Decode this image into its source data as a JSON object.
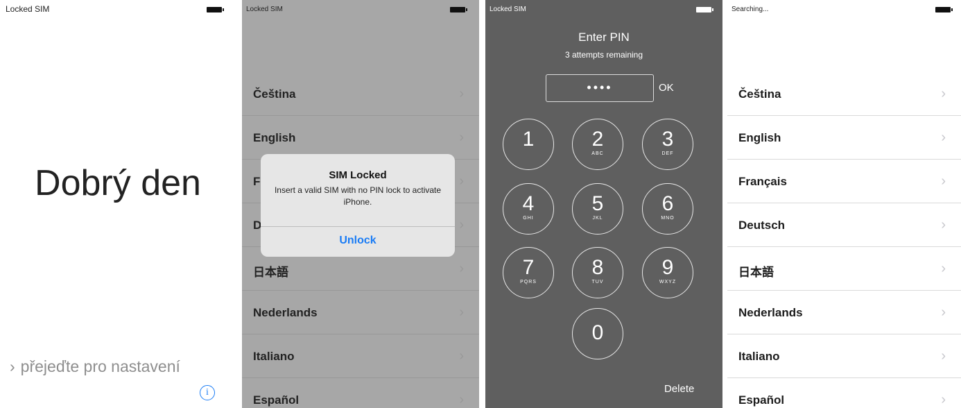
{
  "panel1": {
    "status": "Locked SIM",
    "greeting": "Dobrý den",
    "slide_text": "přejeďte pro nastavení",
    "slide_chevron": "›",
    "info_icon": "i"
  },
  "panel2": {
    "status": "Locked SIM",
    "languages": [
      "Čeština",
      "English",
      "F",
      "D",
      "日本語",
      "Nederlands",
      "Italiano",
      "Español"
    ],
    "chevron": "›",
    "alert": {
      "title": "SIM Locked",
      "message": "Insert a valid SIM with no PIN lock to activate iPhone.",
      "button": "Unlock"
    }
  },
  "panel3": {
    "status": "Locked SIM",
    "title": "Enter PIN",
    "subtitle": "3 attempts remaining",
    "pin_value": "••••",
    "ok": "OK",
    "delete": "Delete",
    "keys": [
      {
        "num": "1",
        "letters": ""
      },
      {
        "num": "2",
        "letters": "ABC"
      },
      {
        "num": "3",
        "letters": "DEF"
      },
      {
        "num": "4",
        "letters": "GHI"
      },
      {
        "num": "5",
        "letters": "JKL"
      },
      {
        "num": "6",
        "letters": "MNO"
      },
      {
        "num": "7",
        "letters": "PQRS"
      },
      {
        "num": "8",
        "letters": "TUV"
      },
      {
        "num": "9",
        "letters": "WXYZ"
      },
      {
        "num": "0",
        "letters": ""
      }
    ]
  },
  "panel4": {
    "status": "Searching...",
    "languages": [
      "Čeština",
      "English",
      "Français",
      "Deutsch",
      "日本語",
      "Nederlands",
      "Italiano",
      "Español"
    ],
    "chevron": "›"
  },
  "colors": {
    "accent": "#1a7cf5",
    "dimmed_background": "#a7a7a7",
    "pin_background": "#5f5f5f"
  }
}
